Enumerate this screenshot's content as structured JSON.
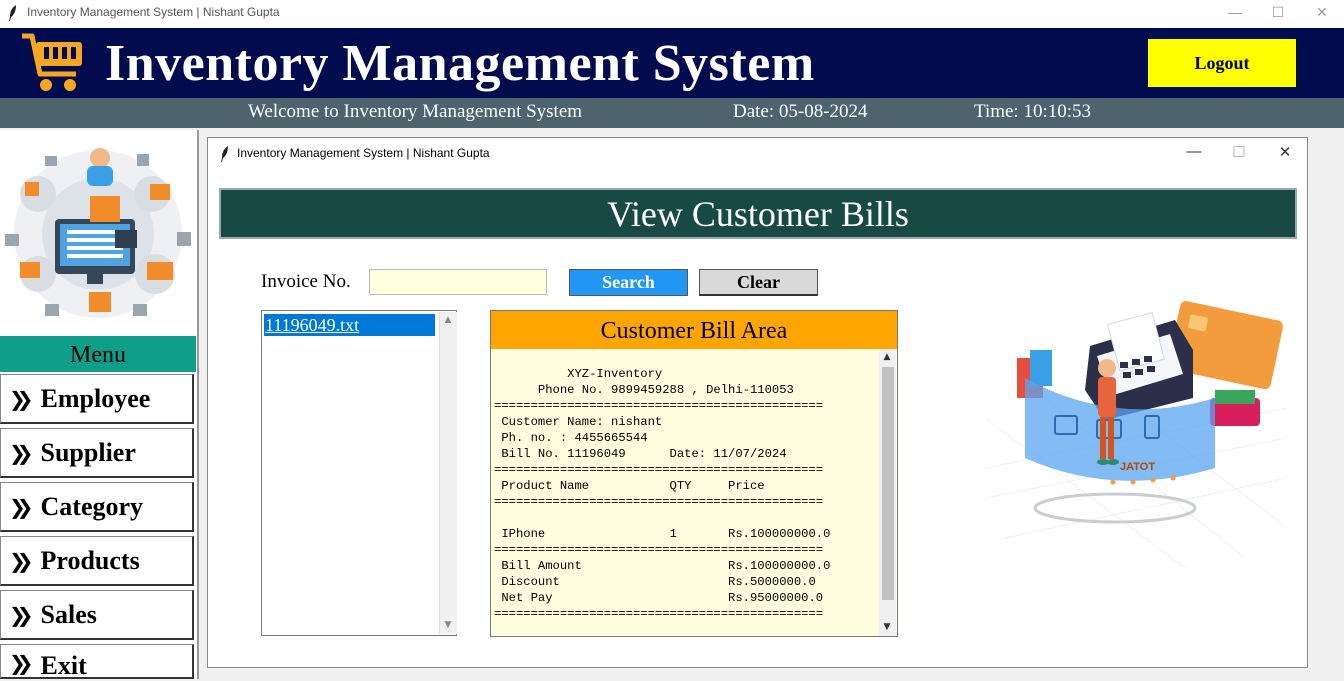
{
  "os_window": {
    "title": "Inventory Management System | Nishant Gupta",
    "controls": [
      "—",
      "☐",
      "✕"
    ]
  },
  "header": {
    "app_title": "Inventory Management System",
    "logout_label": "Logout",
    "icon": "shopping-cart-icon",
    "bg_color": "#010c4f",
    "logout_color": "#ffff00"
  },
  "infobar": {
    "welcome": "Welcome to Inventory Management System",
    "date": "Date: 05-08-2024",
    "time": "Time: 10:10:53"
  },
  "sidebar": {
    "menu_title": "Menu",
    "items": [
      {
        "label": "Employee",
        "icon": "double-chevron-right-icon"
      },
      {
        "label": "Supplier",
        "icon": "double-chevron-right-icon"
      },
      {
        "label": "Category",
        "icon": "double-chevron-right-icon"
      },
      {
        "label": "Products",
        "icon": "double-chevron-right-icon"
      },
      {
        "label": "Sales",
        "icon": "double-chevron-right-icon"
      },
      {
        "label": "Exit",
        "icon": "double-chevron-right-icon"
      }
    ]
  },
  "sales_window": {
    "title": "Inventory Management System | Nishant Gupta",
    "controls": [
      "—",
      "☐",
      "✕"
    ],
    "heading": "View Customer Bills",
    "invoice_label": "Invoice No.",
    "invoice_value": "",
    "search_label": "Search",
    "clear_label": "Clear",
    "bill_files": [
      "11196049.txt"
    ],
    "selected_file": "11196049.txt",
    "bill_area_title": "Customer Bill Area",
    "bill_text": "          XYZ-Inventory\n      Phone No. 9899459288 , Delhi-110053\n=============================================\n Customer Name: nishant\n Ph. no. : 4455665544\n Bill No. 11196049      Date: 11/07/2024\n=============================================\n Product Name           QTY     Price\n=============================================\n\n IPhone                 1       Rs.100000000.0\n=============================================\n Bill Amount                    Rs.100000000.0\n Discount                       Rs.5000000.0\n Net Pay                        Rs.95000000.0\n=============================================",
    "illustration_text": "JATOT"
  }
}
